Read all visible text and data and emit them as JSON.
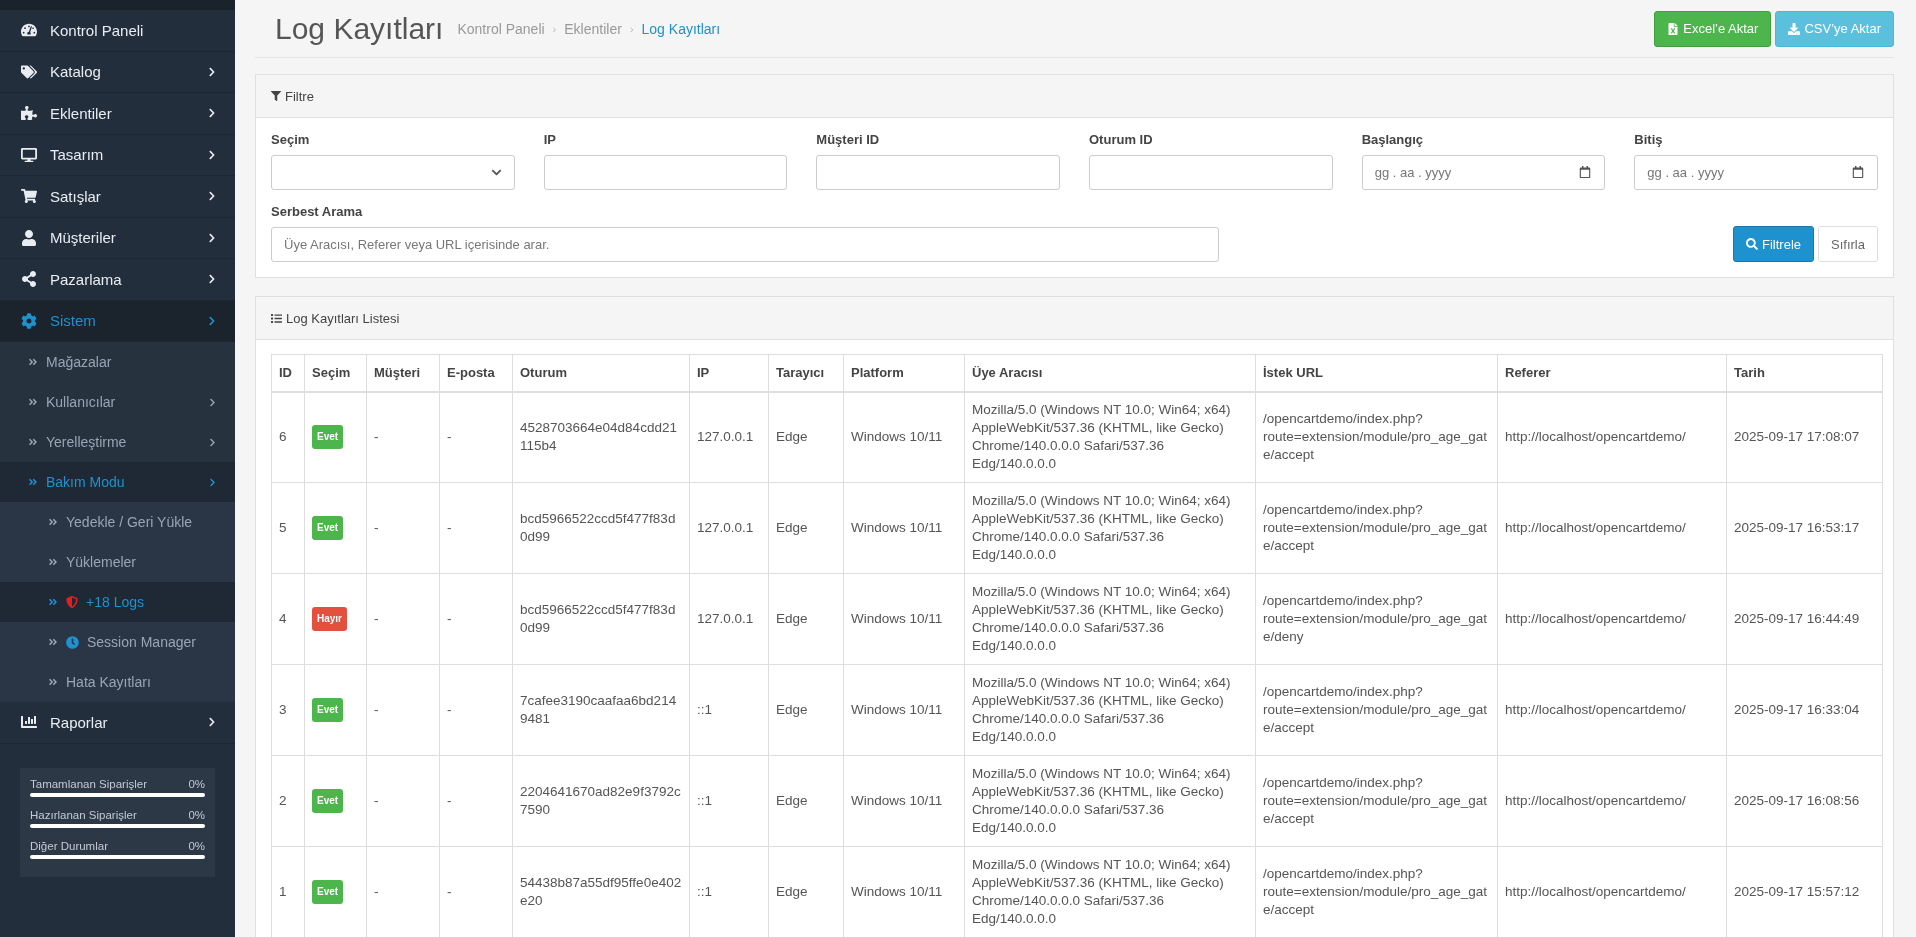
{
  "sidebar": {
    "items": [
      {
        "label": "Kontrol Paneli",
        "expandable": false,
        "selected": false
      },
      {
        "label": "Katalog",
        "expandable": true,
        "selected": false
      },
      {
        "label": "Eklentiler",
        "expandable": true,
        "selected": false
      },
      {
        "label": "Tasarım",
        "expandable": true,
        "selected": false
      },
      {
        "label": "Satışlar",
        "expandable": true,
        "selected": false
      },
      {
        "label": "Müşteriler",
        "expandable": true,
        "selected": false
      },
      {
        "label": "Pazarlama",
        "expandable": true,
        "selected": false
      },
      {
        "label": "Sistem",
        "expandable": true,
        "selected": true,
        "expanded": true,
        "children": [
          {
            "label": "Mağazalar",
            "expandable": false,
            "selected": false
          },
          {
            "label": "Kullanıcılar",
            "expandable": true,
            "selected": false
          },
          {
            "label": "Yerelleştirme",
            "expandable": true,
            "selected": false
          },
          {
            "label": "Bakım Modu",
            "expandable": true,
            "selected": true,
            "expanded": true,
            "children": [
              {
                "label": "Yedekle / Geri Yükle",
                "selected": false
              },
              {
                "label": "Yüklemeler",
                "selected": false
              },
              {
                "label": "+18 Logs",
                "selected": true
              },
              {
                "label": "Session Manager",
                "selected": false
              },
              {
                "label": "Hata Kayıtları",
                "selected": false
              }
            ]
          }
        ]
      },
      {
        "label": "Raporlar",
        "expandable": true,
        "selected": false
      }
    ],
    "stats": [
      {
        "label": "Tamamlanan Siparişler",
        "reading": "0%"
      },
      {
        "label": "Hazırlanan Siparişler",
        "reading": "0%"
      },
      {
        "label": "Diğer Durumlar",
        "reading": "0%"
      }
    ]
  },
  "header": {
    "title": "Log Kayıtları",
    "breadcrumb": [
      {
        "label": "Kontrol Paneli",
        "selected": false
      },
      {
        "separator": "›",
        "label": "Eklentiler",
        "selected": false
      },
      {
        "separator": "›",
        "label": "Log Kayıtları",
        "selected": true
      }
    ],
    "buttons": [
      {
        "label": "Excel’e Aktar",
        "kind": "excel"
      },
      {
        "label": "CSV’ye Aktar",
        "kind": "csv"
      }
    ]
  },
  "filter": {
    "title": "Filtre",
    "fields": [
      {
        "label": "Seçim",
        "kind": "select"
      },
      {
        "label": "IP",
        "kind": "text"
      },
      {
        "label": "Müşteri ID",
        "kind": "text"
      },
      {
        "label": "Oturum ID",
        "kind": "text"
      },
      {
        "label": "Başlangıç",
        "kind": "date",
        "placeholder": "gg . aa . yyyy"
      },
      {
        "label": "Bitiş",
        "kind": "date",
        "placeholder": "gg . aa . yyyy"
      }
    ],
    "search": {
      "label": "Serbest Arama",
      "placeholder": "Üye Aracısı, Referer veya URL içerisinde arar."
    },
    "buttons": [
      {
        "label": "Filtrele",
        "kind": "primary"
      },
      {
        "label": "Sıfırla",
        "kind": "default"
      }
    ]
  },
  "list": {
    "title": "Log Kayıtları Listesi",
    "columns": [
      "ID",
      "Seçim",
      "Müşteri",
      "E-posta",
      "Oturum",
      "IP",
      "Tarayıcı",
      "Platform",
      "Üye Aracısı",
      "İstek URL",
      "Referer",
      "Tarih"
    ],
    "rows": [
      {
        "id": "6",
        "choice": {
          "text": "Evet",
          "kind": "yes"
        },
        "customer": "-",
        "email": "-",
        "session": "4528703664e04d84cdd21115b4",
        "ip": "127.0.0.1",
        "browser": "Edge",
        "platform": "Windows 10/11",
        "agent": "Mozilla/5.0 (Windows NT 10.0; Win64; x64) AppleWebKit/537.36 (KHTML, like Gecko) Chrome/140.0.0.0 Safari/537.36 Edg/140.0.0.0",
        "url": "/opencartdemo/index.php?route=extension/module/pro_age_gate/accept",
        "referer": "http://localhost/opencartdemo/",
        "date": "2025-09-17 17:08:07"
      },
      {
        "id": "5",
        "choice": {
          "text": "Evet",
          "kind": "yes"
        },
        "customer": "-",
        "email": "-",
        "session": "bcd5966522ccd5f477f83d0d99",
        "ip": "127.0.0.1",
        "browser": "Edge",
        "platform": "Windows 10/11",
        "agent": "Mozilla/5.0 (Windows NT 10.0; Win64; x64) AppleWebKit/537.36 (KHTML, like Gecko) Chrome/140.0.0.0 Safari/537.36 Edg/140.0.0.0",
        "url": "/opencartdemo/index.php?route=extension/module/pro_age_gate/accept",
        "referer": "http://localhost/opencartdemo/",
        "date": "2025-09-17 16:53:17"
      },
      {
        "id": "4",
        "choice": {
          "text": "Hayır",
          "kind": "no"
        },
        "customer": "-",
        "email": "-",
        "session": "bcd5966522ccd5f477f83d0d99",
        "ip": "127.0.0.1",
        "browser": "Edge",
        "platform": "Windows 10/11",
        "agent": "Mozilla/5.0 (Windows NT 10.0; Win64; x64) AppleWebKit/537.36 (KHTML, like Gecko) Chrome/140.0.0.0 Safari/537.36 Edg/140.0.0.0",
        "url": "/opencartdemo/index.php?route=extension/module/pro_age_gate/deny",
        "referer": "http://localhost/opencartdemo/",
        "date": "2025-09-17 16:44:49"
      },
      {
        "id": "3",
        "choice": {
          "text": "Evet",
          "kind": "yes"
        },
        "customer": "-",
        "email": "-",
        "session": "7cafee3190caafaa6bd2149481",
        "ip": "::1",
        "browser": "Edge",
        "platform": "Windows 10/11",
        "agent": "Mozilla/5.0 (Windows NT 10.0; Win64; x64) AppleWebKit/537.36 (KHTML, like Gecko) Chrome/140.0.0.0 Safari/537.36 Edg/140.0.0.0",
        "url": "/opencartdemo/index.php?route=extension/module/pro_age_gate/accept",
        "referer": "http://localhost/opencartdemo/",
        "date": "2025-09-17 16:33:04"
      },
      {
        "id": "2",
        "choice": {
          "text": "Evet",
          "kind": "yes"
        },
        "customer": "-",
        "email": "-",
        "session": "2204641670ad82e9f3792c7590",
        "ip": "::1",
        "browser": "Edge",
        "platform": "Windows 10/11",
        "agent": "Mozilla/5.0 (Windows NT 10.0; Win64; x64) AppleWebKit/537.36 (KHTML, like Gecko) Chrome/140.0.0.0 Safari/537.36 Edg/140.0.0.0",
        "url": "/opencartdemo/index.php?route=extension/module/pro_age_gate/accept",
        "referer": "http://localhost/opencartdemo/",
        "date": "2025-09-17 16:08:56"
      },
      {
        "id": "1",
        "choice": {
          "text": "Evet",
          "kind": "yes"
        },
        "customer": "-",
        "email": "-",
        "session": "54438b87a55df95ffe0e402e20",
        "ip": "::1",
        "browser": "Edge",
        "platform": "Windows 10/11",
        "agent": "Mozilla/5.0 (Windows NT 10.0; Win64; x64) AppleWebKit/537.36 (KHTML, like Gecko) Chrome/140.0.0.0 Safari/537.36 Edg/140.0.0.0",
        "url": "/opencartdemo/index.php?route=extension/module/pro_age_gate/accept",
        "referer": "http://localhost/opencartdemo/",
        "date": "2025-09-17 15:57:12"
      }
    ]
  }
}
